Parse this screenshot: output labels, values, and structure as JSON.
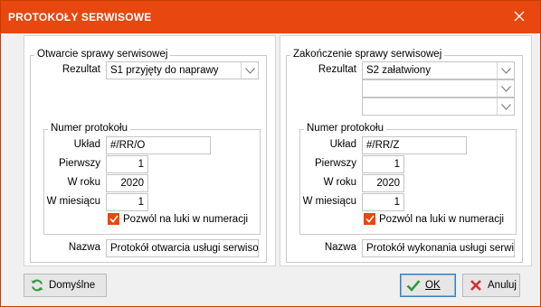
{
  "window": {
    "title": "PROTOKOŁY SERWISOWE",
    "close_icon": "close-icon",
    "accent": "#e8470f"
  },
  "left": {
    "group_title": "Otwarcie sprawy serwisowej",
    "rezultat_label": "Rezultat",
    "rezultat_value": "S1 przyjęty do naprawy",
    "numer": {
      "title": "Numer protokołu",
      "uklad_label": "Układ",
      "uklad_value": "#/RR/O",
      "pierwszy_label": "Pierwszy",
      "pierwszy_value": "1",
      "wroku_label": "W roku",
      "wroku_value": "2020",
      "wmiesiacu_label": "W miesiącu",
      "wmiesiacu_value": "1",
      "luki_label": "Pozwól na luki w numeracji",
      "luki_checked": true
    },
    "nazwa_label": "Nazwa",
    "nazwa_value": "Protokół otwarcia usługi serwisowej"
  },
  "right": {
    "group_title": "Zakończenie sprawy serwisowej",
    "rezultat_label": "Rezultat",
    "rezultat_values": [
      "S2 załatwiony",
      "",
      ""
    ],
    "numer": {
      "title": "Numer protokołu",
      "uklad_label": "Układ",
      "uklad_value": "#/RR/Z",
      "pierwszy_label": "Pierwszy",
      "pierwszy_value": "1",
      "wroku_label": "W roku",
      "wroku_value": "2020",
      "wmiesiacu_label": "W miesiącu",
      "wmiesiacu_value": "1",
      "luki_label": "Pozwól na luki w numeracji",
      "luki_checked": true
    },
    "nazwa_label": "Nazwa",
    "nazwa_value": "Protokół wykonania usługi serwisowej"
  },
  "buttons": {
    "defaults_label": "Domyślne",
    "ok_label": "OK",
    "cancel_label": "Anuluj"
  }
}
